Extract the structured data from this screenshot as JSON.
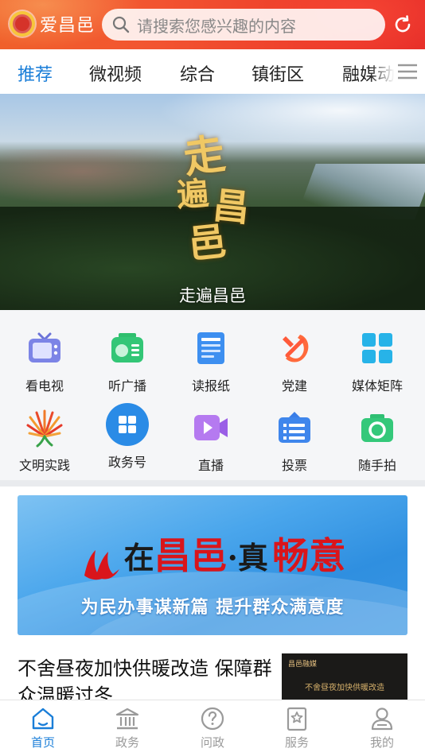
{
  "header": {
    "app_name": "爱昌邑",
    "search_placeholder": "请搜索您感兴趣的内容"
  },
  "tabs": [
    {
      "label": "推荐",
      "active": true
    },
    {
      "label": "微视频"
    },
    {
      "label": "综合"
    },
    {
      "label": "镇街区"
    },
    {
      "label": "融媒动"
    }
  ],
  "banner": {
    "calligraphy": [
      "走",
      "遍",
      "昌",
      "邑"
    ],
    "caption": "走遍昌邑"
  },
  "grid": [
    {
      "label": "看电视",
      "icon": "tv-icon"
    },
    {
      "label": "听广播",
      "icon": "radio-icon"
    },
    {
      "label": "读报纸",
      "icon": "newspaper-icon"
    },
    {
      "label": "党建",
      "icon": "party-emblem-icon"
    },
    {
      "label": "媒体矩阵",
      "icon": "matrix-icon"
    },
    {
      "label": "文明实践",
      "icon": "civilization-icon"
    },
    {
      "label": "政务号",
      "icon": "government-account-icon"
    },
    {
      "label": "直播",
      "icon": "live-video-icon"
    },
    {
      "label": "投票",
      "icon": "vote-icon"
    },
    {
      "label": "随手拍",
      "icon": "camera-icon"
    }
  ],
  "ad": {
    "headline_1": "在",
    "headline_2": "昌邑",
    "headline_3": "·真",
    "headline_4": "畅意",
    "subtitle": "为民办事谋新篇 提升群众满意度"
  },
  "news": {
    "title": "不舍昼夜加快供暖改造 保障群众温暖过冬",
    "thumb_logo": "昌邑融媒",
    "thumb_caption": "不舍昼夜加快供暖改造"
  },
  "bottom_nav": [
    {
      "label": "首页",
      "icon": "home-icon",
      "active": true
    },
    {
      "label": "政务",
      "icon": "government-building-icon"
    },
    {
      "label": "问政",
      "icon": "question-icon"
    },
    {
      "label": "服务",
      "icon": "service-bookmark-icon"
    },
    {
      "label": "我的",
      "icon": "user-icon"
    }
  ],
  "colors": {
    "accent": "#1a7ed8",
    "header_red": "#ee3d2b"
  }
}
